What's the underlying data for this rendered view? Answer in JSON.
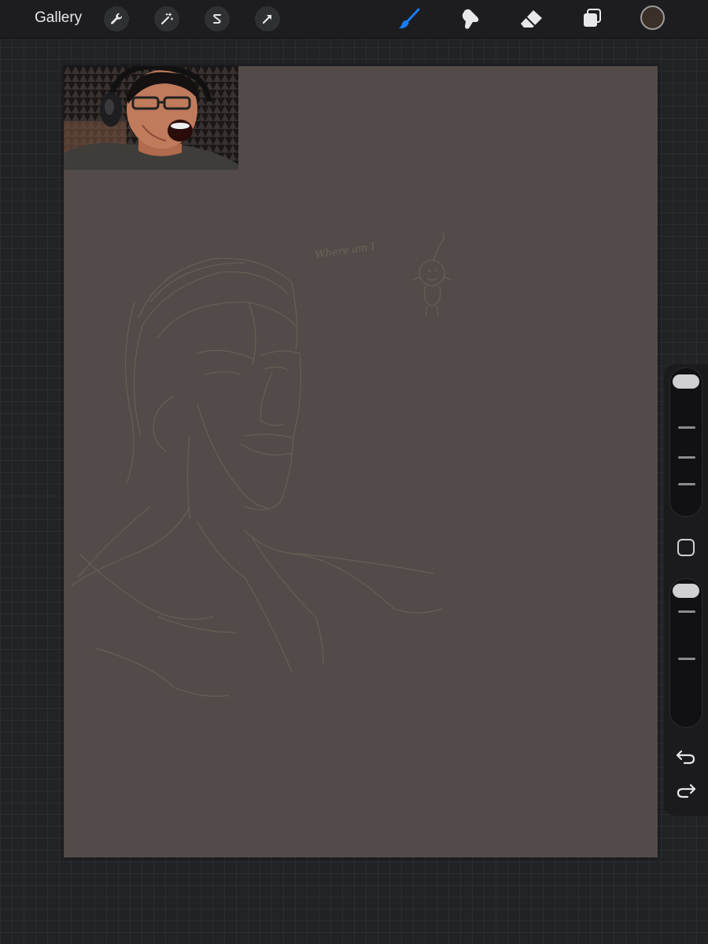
{
  "toolbar": {
    "gallery_label": "Gallery",
    "actions_icon": "wrench-icon",
    "adjustments_icon": "magic-wand-icon",
    "selection_icon": "selection-s-icon",
    "transform_icon": "arrow-cursor-icon",
    "brush_icon": "paintbrush-icon",
    "smudge_icon": "smudge-icon",
    "eraser_icon": "eraser-icon",
    "layers_icon": "layers-icon",
    "active_tool": "brush",
    "active_color": "#3a3027",
    "accent_color": "#1a7cf5"
  },
  "canvas": {
    "background_color": "#534b49",
    "sketch_text": "Where am I",
    "reference_image": "reference photo of man wearing headphones screaming"
  },
  "sidebar": {
    "brush_size_level": 1.0,
    "opacity_level": 1.0,
    "modifier_icon": "square-modifier-icon",
    "undo_icon": "undo-icon",
    "redo_icon": "redo-icon"
  }
}
